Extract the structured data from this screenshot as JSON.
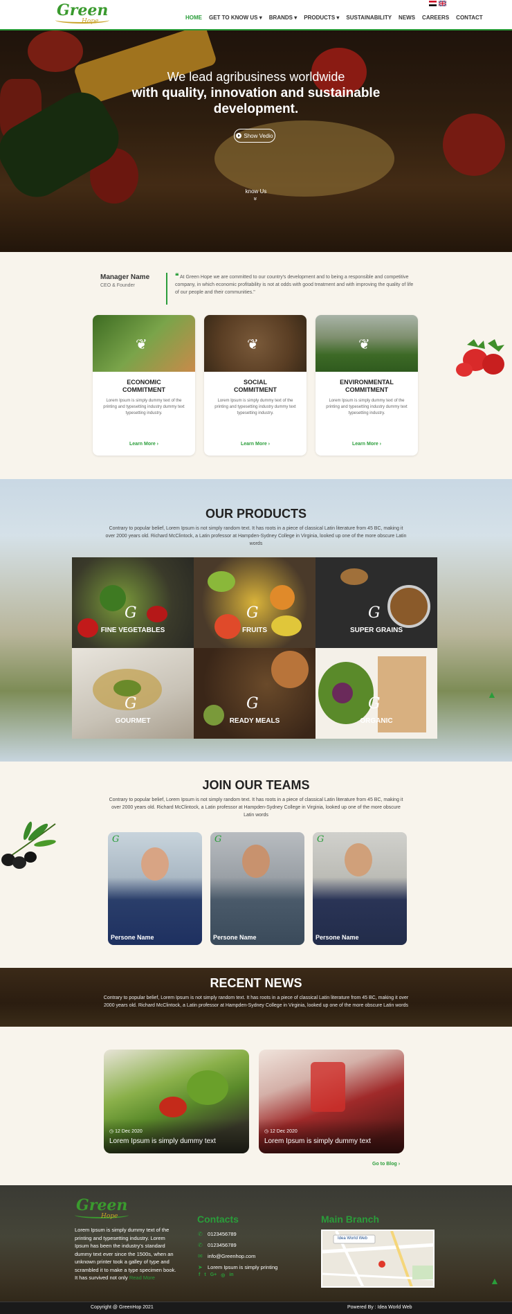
{
  "header": {
    "logo_text": "Green",
    "logo_sub": "Hope",
    "nav": [
      "HOME",
      "GET TO KNOW US",
      "BRANDS",
      "PRODUCTS",
      "SUSTAINABILITY",
      "NEWS",
      "CAREERS",
      "CONTACT"
    ],
    "nav_dropdown_marker": "▾"
  },
  "hero": {
    "title_line1": "We lead agribusiness worldwide",
    "title_line2": "with quality, innovation and sustainable",
    "title_line3": "development.",
    "video_button": "Show Vedio",
    "know_us": "know Us",
    "arrow": "»"
  },
  "manager": {
    "name": "Manager Name",
    "role": "CEO & Founder",
    "quote": "At Green Hope we are committed to our country's development and to being a responsible and competitive company, in which economic profitability is not at odds with good treatment and with improving the quality of life of our people and their communities.\""
  },
  "commitments": [
    {
      "title1": "ECONOMIC",
      "title2": "COMMITMENT",
      "desc": "Lorem Ipsum is simply dummy text of the printing and typesetting industry dummy text typesetting industry.",
      "link": "Learn More ›"
    },
    {
      "title1": "SOCIAL",
      "title2": "COMMITMENT",
      "desc": "Lorem Ipsum is simply dummy text of the printing and typesetting industry dummy text typesetting industry.",
      "link": "Learn More ›"
    },
    {
      "title1": "ENVIRONMENTAL",
      "title2": "COMMITMENT",
      "desc": "Lorem Ipsum is simply dummy text of the printing and typesetting industry dummy text typesetting industry.",
      "link": "Learn More ›"
    }
  ],
  "products": {
    "title": "OUR PRODUCTS",
    "desc": "Contrary to popular belief, Lorem Ipsum is not simply random text. It has roots in a piece of classical Latin literature from 45 BC, making it over 2000 years old. Richard McClintock, a Latin professor at Hampden-Sydney College in Virginia, looked up one of the more obscure Latin words",
    "items": [
      "FINE VEGETABLES",
      "FRUITS",
      "SUPER GRAINS",
      "GOURMET",
      "READY MEALS",
      "ORGANIC"
    ],
    "glyph": "G"
  },
  "teams": {
    "title": "JOIN OUR TEAMS",
    "desc": "Contrary to popular belief, Lorem Ipsum is not simply random text. It has roots in a piece of classical Latin literature from 45 BC, making it over 2000 years old. Richard McClintock, a Latin professor at Hampden-Sydney College in Virginia, looked up one of the more obscure Latin words",
    "members": [
      "Persone Name",
      "Persone Name",
      "Persone Name"
    ]
  },
  "news": {
    "title": "RECENT NEWS",
    "desc": "Contrary to popular belief, Lorem Ipsum is not simply random text. It has roots in a piece of classical Latin literature from 45 BC, making it over 2000 years old. Richard McClintock, a Latin professor at Hampden-Sydney College in Virginia, looked up one of the more obscure Latin words",
    "posts": [
      {
        "date": "12 Dec 2020",
        "title": "Lorem Ipsum is simply dummy text"
      },
      {
        "date": "12 Dec 2020",
        "title": "Lorem Ipsum is simply dummy text"
      }
    ],
    "go_to_blog": "Go to Blog ›"
  },
  "footer": {
    "about": "Lorem Ipsum is simply dummy text of the printing and typesetting industry. Lorem Ipsum has been the industry's standard dummy text ever since the 1500s, when an unknown printer took a galley of type and scrambled it to make a type specimen book. It has survived not only",
    "read_more": "Read More",
    "contacts_title": "Contacts",
    "phone1": "0123456789",
    "phone2": "0123456789",
    "email": "info@Greenhop.com",
    "address": "Lorem Ipsum is simply printing",
    "social": [
      "f",
      "t",
      "G+",
      "◎",
      "in"
    ],
    "branch_title": "Main Branch",
    "map_label": "Idea World Web",
    "copyright": "Copyright @ GreenHop 2021",
    "powered": "Powered By : Idea World Web"
  },
  "colors": {
    "accent": "#2a9d3a",
    "gold": "#c9a227",
    "bg": "#f8f4ec"
  }
}
